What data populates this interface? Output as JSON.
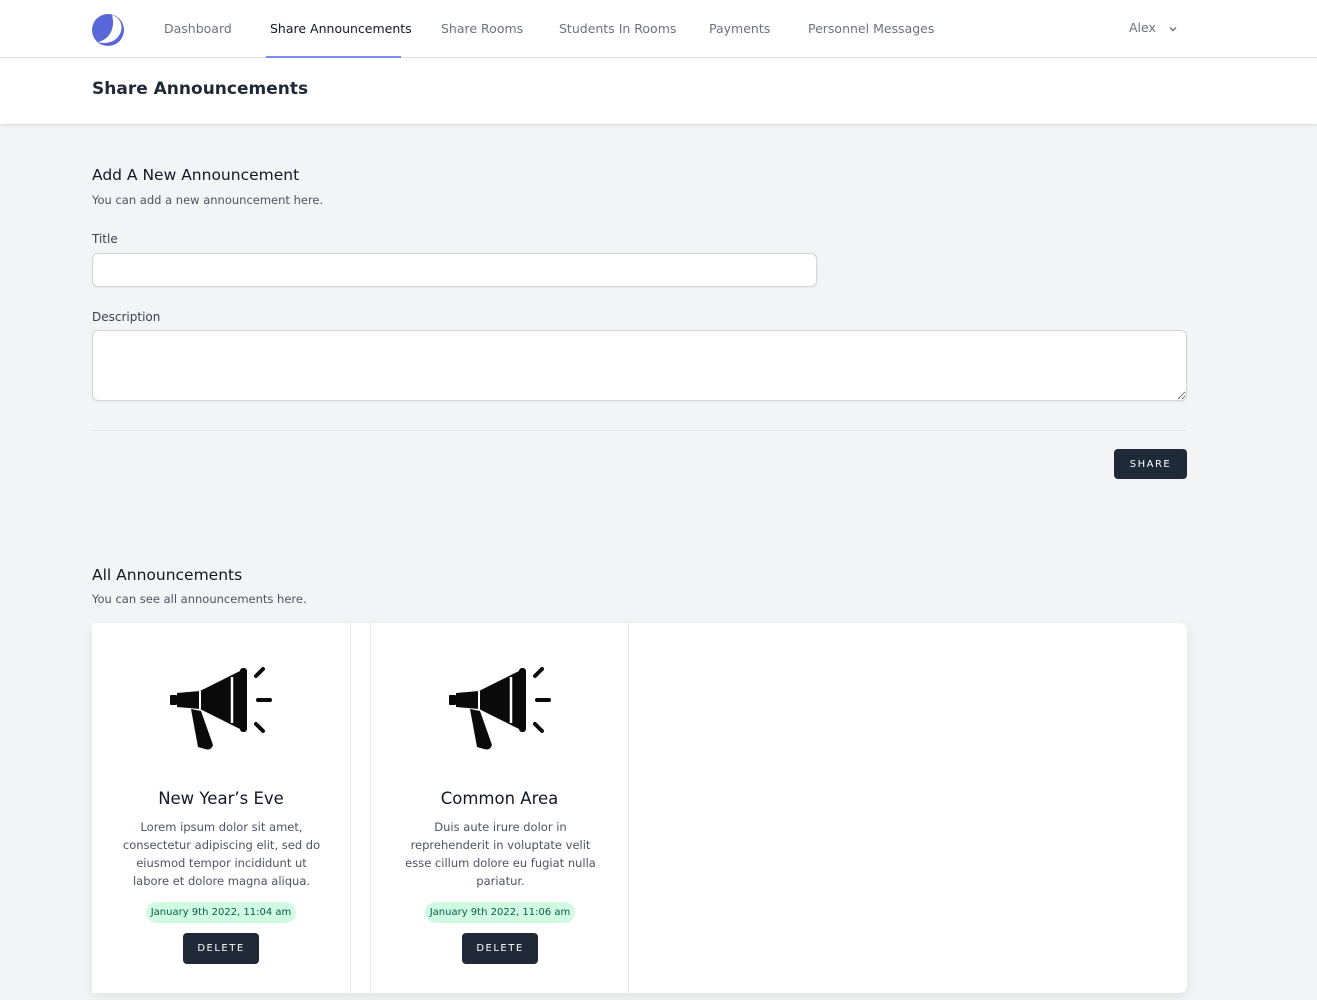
{
  "nav": {
    "items": [
      {
        "label": "Dashboard"
      },
      {
        "label": "Share Announcements"
      },
      {
        "label": "Share Rooms"
      },
      {
        "label": "Students In Rooms"
      },
      {
        "label": "Payments"
      },
      {
        "label": "Personnel Messages"
      }
    ],
    "active_index": 1,
    "user_name": "Alex",
    "accent_color": "#818cf8"
  },
  "page": {
    "title": "Share Announcements"
  },
  "add_section": {
    "title": "Add A New Announcement",
    "description": "You can add a new announcement here.",
    "title_label": "Title",
    "title_value": "",
    "description_label": "Description",
    "description_value": "",
    "share_label": "Share"
  },
  "list_section": {
    "title": "All Announcements",
    "description": "You can see all announcements here."
  },
  "announcements": [
    {
      "icon": "megaphone-icon",
      "title": "New Year’s Eve",
      "body": "Lorem ipsum dolor sit amet, consectetur adipiscing elit, sed do eiusmod tempor incididunt ut labore et dolore magna aliqua.",
      "date": "January 9th 2022, 11:04 am",
      "delete_label": "Delete"
    },
    {
      "icon": "megaphone-icon",
      "title": "Common Area",
      "body": "Duis aute irure dolor in reprehenderit in voluptate velit esse cillum dolore eu fugiat nulla pariatur.",
      "date": "January 9th 2022, 11:06 am",
      "delete_label": "Delete"
    }
  ],
  "colors": {
    "button_dark": "#1f2937",
    "date_badge_bg": "#d1fae5",
    "date_badge_text": "#065f46",
    "logo": "#5a67d8"
  }
}
